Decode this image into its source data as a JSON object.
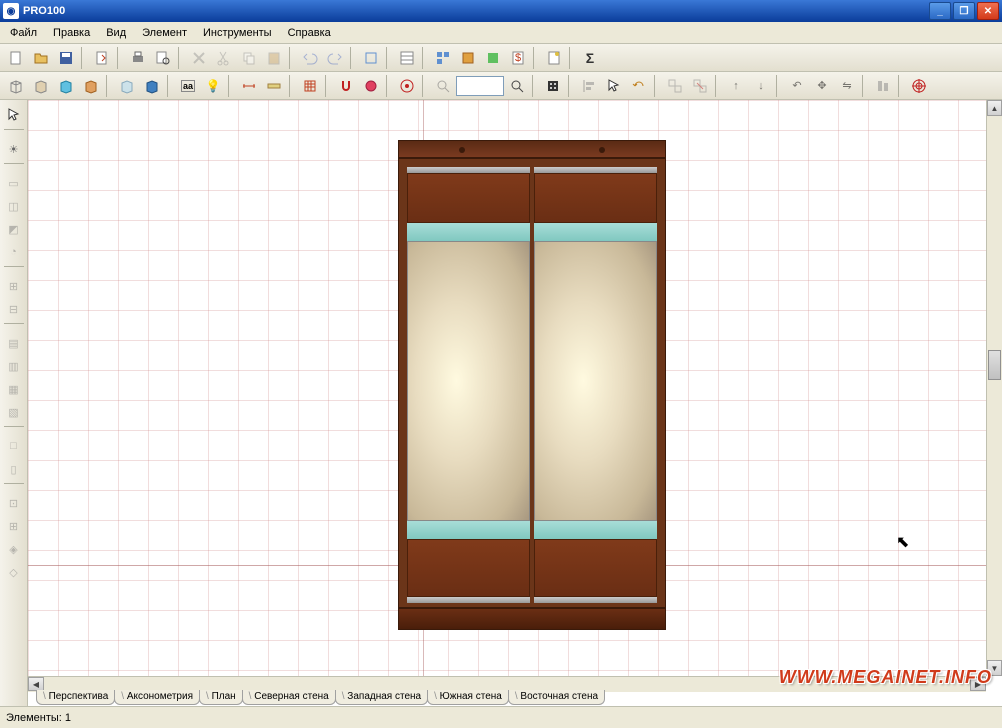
{
  "title": "PRO100",
  "menu": [
    "Файл",
    "Правка",
    "Вид",
    "Элемент",
    "Инструменты",
    "Справка"
  ],
  "view_tabs": [
    "Перспектива",
    "Аксонометрия",
    "План",
    "Северная стена",
    "Западная стена",
    "Южная стена",
    "Восточная стена"
  ],
  "status": "Элементы: 1",
  "watermark": "WWW.MEGAINET.INFO"
}
